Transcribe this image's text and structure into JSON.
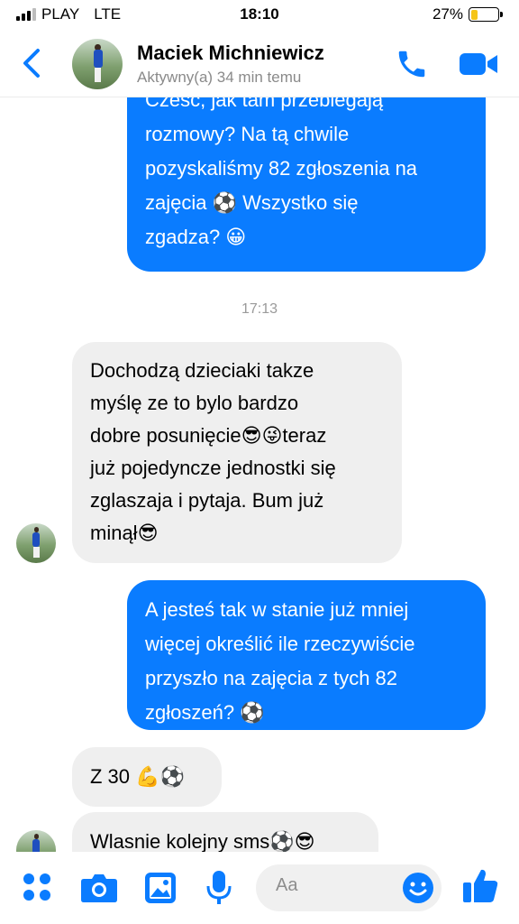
{
  "status_bar": {
    "carrier": "PLAY",
    "network": "LTE",
    "time": "18:10",
    "battery": "27%",
    "battery_level": 0.27
  },
  "header": {
    "name": "Maciek Michniewicz",
    "presence": "Aktywny(a) 34 min temu",
    "icons": [
      "back-chevron-icon",
      "phone-icon",
      "video-call-icon"
    ]
  },
  "messages": [
    {
      "type": "outgoing",
      "lines": [
        "Czesc, jak tam przebiegają",
        "rozmowy? Na tą chwile",
        "pozyskaliśmy 82 zgłoszenia na",
        "zajęcia ⚽ Wszystko się",
        "zgadza? 😀"
      ]
    },
    {
      "type": "timestamp",
      "text": "17:13"
    },
    {
      "type": "incoming",
      "lines": [
        "Dochodzą dzieciaki takze",
        "myślę ze to bylo bardzo",
        "dobre posunięcie😎😜teraz",
        "już pojedyncze jednostki się",
        "zglaszaja i pytaja. Bum już",
        "minął😎"
      ]
    },
    {
      "type": "outgoing",
      "lines": [
        "A jesteś tak w stanie już mniej",
        "więcej określić ile rzeczywiście",
        "przyszło na zajęcia z tych 82",
        "zgłoszeń? ⚽"
      ]
    },
    {
      "type": "incoming",
      "lines": [
        "Z 30 💪⚽"
      ]
    },
    {
      "type": "incoming",
      "lines": [
        "Wlasnie kolejny sms⚽😎"
      ]
    }
  ],
  "composer": {
    "placeholder": "Aa"
  },
  "toolbar": {
    "icons": [
      "menu-dots-icon",
      "camera-icon",
      "gallery-icon",
      "microphone-icon",
      "emoji-icon",
      "like-icon"
    ]
  },
  "colors": {
    "accent": "#0a7cff",
    "incoming_bubble": "#efefef",
    "battery_fill": "#f5c518"
  }
}
